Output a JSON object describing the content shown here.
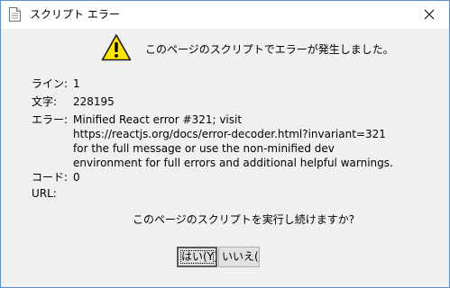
{
  "window": {
    "title": "スクリプト エラー",
    "title_icon": "document-icon",
    "close_icon": "close-icon"
  },
  "header": {
    "icon": "warning-icon",
    "message": "このページのスクリプトでエラーが発生しました。"
  },
  "details": {
    "line_label": "ライン:",
    "line_value": "1",
    "char_label": "文字:",
    "char_value": "228195",
    "error_label": "エラー:",
    "error_value": "Minified React error #321; visit https://reactjs.org/docs/error-decoder.html?invariant=321 for the full message or use the non-minified dev environment for full errors and additional helpful warnings.",
    "code_label": "コード:",
    "code_value": "0",
    "url_label": "URL:",
    "url_value": ""
  },
  "question": "このページのスクリプトを実行し続けますか?",
  "buttons": {
    "yes_label": "はい(Y)",
    "no_label": "いいえ(N"
  },
  "colors": {
    "warning_fill": "#ffe600",
    "border": "#5a8fd6"
  }
}
